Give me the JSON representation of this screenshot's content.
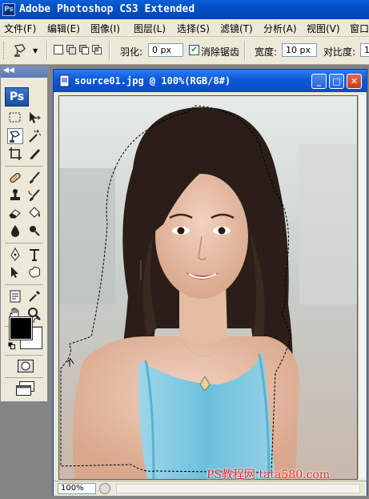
{
  "app": {
    "title": "Adobe Photoshop CS3 Extended",
    "icon_label": "Ps"
  },
  "menu": [
    "文件(F)",
    "编辑(E)",
    "图像(I)",
    "图层(L)",
    "选择(S)",
    "滤镜(T)",
    "分析(A)",
    "视图(V)",
    "窗口"
  ],
  "options": {
    "feather_label": "羽化:",
    "feather_value": "0 px",
    "antialias_label": "消除锯齿",
    "antialias_checked": true,
    "width_label": "宽度:",
    "width_value": "10 px",
    "contrast_label": "对比度:",
    "contrast_value": "1"
  },
  "toolbox": {
    "logo": "Ps",
    "collapse": "◀◀",
    "tools": [
      "rectangular-marquee",
      "move",
      "magnetic-lasso",
      "magic-wand",
      "crop",
      "slice",
      "healing-brush",
      "brush",
      "clone-stamp",
      "history-brush",
      "eraser",
      "paint-bucket",
      "blur",
      "dodge",
      "pen",
      "type",
      "path-selection",
      "custom-shape",
      "notes",
      "eyedropper",
      "hand",
      "zoom"
    ],
    "foreground_color": "#000000",
    "background_color": "#ffffff"
  },
  "document": {
    "title": "source01.jpg @ 100%(RGB/8#)",
    "zoom": "100%"
  },
  "watermark": "PS教程网 tata580.com",
  "colors": {
    "titlebar": "#0350c4",
    "chrome": "#ece9d8",
    "workspace": "#848484"
  }
}
